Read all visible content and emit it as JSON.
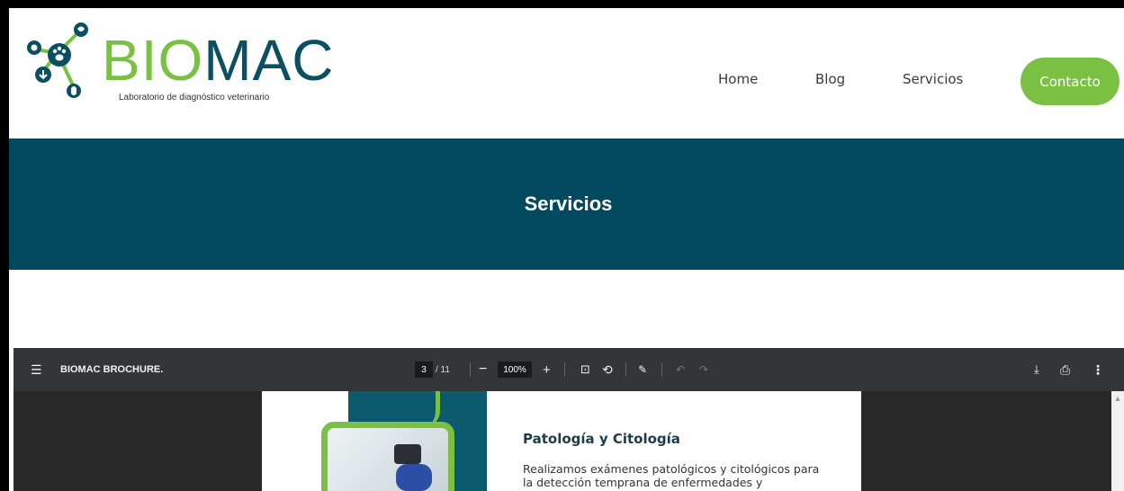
{
  "header": {
    "logo": {
      "bio": "BIO",
      "mac": "MAC",
      "tagline": "Laboratorio de diagnóstico veterinario"
    },
    "nav": {
      "home": "Home",
      "blog": "Blog",
      "servicios": "Servicios",
      "contacto": "Contacto"
    }
  },
  "banner": {
    "title": "Servicios"
  },
  "viewer": {
    "doc_title": "BIOMAC BROCHURE.",
    "page_current": "3",
    "page_total": "/ 11",
    "zoom": "100%",
    "zoom_out": "−",
    "zoom_in": "+",
    "icons": {
      "menu": "☰",
      "fit": "⊡",
      "rotate": "⟲",
      "draw": "✎",
      "undo": "↶",
      "redo": "↷",
      "download": "⤓",
      "print": "⎙",
      "more": "⋮",
      "scroll_up": "▲"
    }
  },
  "pdf_page": {
    "heading": "Patología y Citología",
    "body": "Realizamos exámenes patológicos y citológicos para la detección temprana de enfermedades y condiciones"
  },
  "colors": {
    "brand_green": "#7ac143",
    "brand_teal": "#00495e",
    "toolbar": "#323639"
  }
}
